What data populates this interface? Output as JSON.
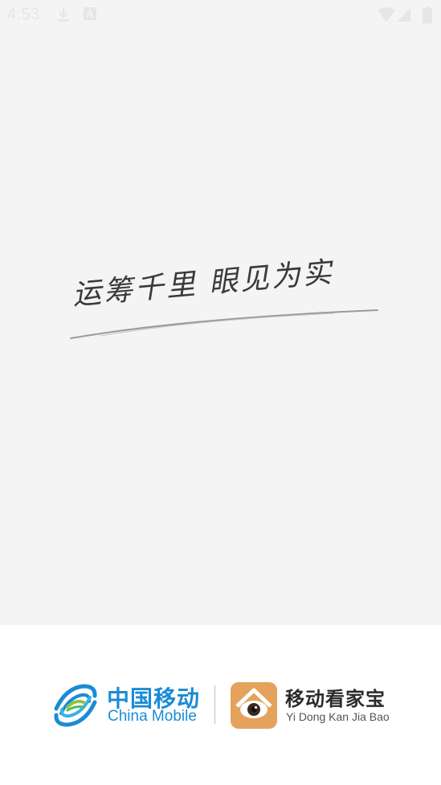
{
  "status_bar": {
    "time": "4:53",
    "icons": [
      "download-icon",
      "text-a-icon",
      "wifi-icon",
      "signal-icon",
      "battery-icon"
    ]
  },
  "splash": {
    "slogan": "运筹千里 眼见为实"
  },
  "footer": {
    "brand": {
      "name_cn": "中国移动",
      "name_en": "China Mobile",
      "color": "#1b8bd5"
    },
    "app": {
      "name_cn": "移动看家宝",
      "name_en": "Yi Dong Kan Jia Bao",
      "color": "#e5a25d"
    }
  }
}
